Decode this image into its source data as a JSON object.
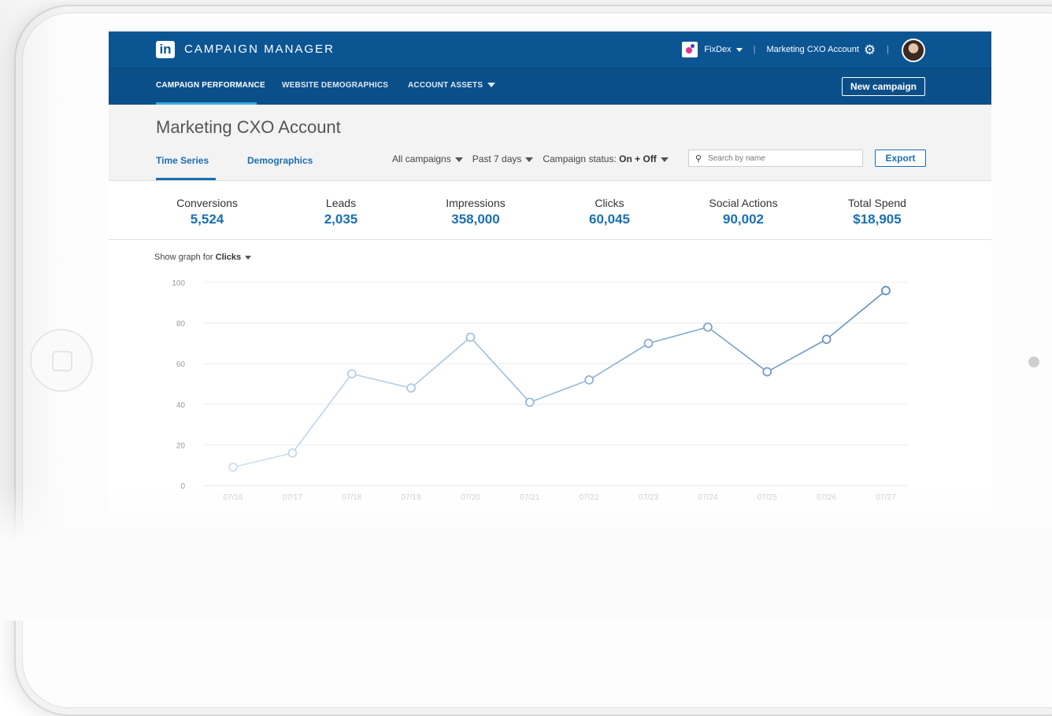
{
  "header": {
    "logo_text": "in",
    "app_title": "CAMPAIGN MANAGER",
    "org_name": "FixDex",
    "account_name": "Marketing CXO Account"
  },
  "nav": {
    "items": [
      {
        "label": "CAMPAIGN PERFORMANCE",
        "active": true
      },
      {
        "label": "WEBSITE DEMOGRAPHICS",
        "active": false
      },
      {
        "label": "ACCOUNT ASSETS",
        "active": false
      }
    ],
    "new_campaign_label": "New campaign"
  },
  "page": {
    "title": "Marketing CXO Account",
    "tabs": [
      {
        "label": "Time Series",
        "active": true
      },
      {
        "label": "Demographics",
        "active": false
      }
    ],
    "filters": {
      "campaigns": "All campaigns",
      "date_range": "Past 7 days",
      "status_label": "Campaign status:",
      "status_value": "On + Off"
    },
    "search_placeholder": "Search by name",
    "export_label": "Export"
  },
  "metrics": [
    {
      "label": "Conversions",
      "value": "5,524"
    },
    {
      "label": "Leads",
      "value": "2,035"
    },
    {
      "label": "Impressions",
      "value": "358,000"
    },
    {
      "label": "Clicks",
      "value": "60,045"
    },
    {
      "label": "Social Actions",
      "value": "90,002"
    },
    {
      "label": "Total Spend",
      "value": "$18,905"
    }
  ],
  "graph": {
    "show_label": "Show graph for",
    "metric": "Clicks"
  },
  "colors": {
    "topbar": "#0c5593",
    "accent": "#1a6fb5",
    "line": "#7aa6cf"
  },
  "chart_data": {
    "type": "line",
    "x": [
      "07/16",
      "07/17",
      "07/18",
      "07/19",
      "07/20",
      "07/21",
      "07/22",
      "07/23",
      "07/24",
      "07/25",
      "07/26",
      "07/27"
    ],
    "series": [
      {
        "values": [
          9,
          16,
          55,
          48,
          73,
          41,
          52,
          70,
          78,
          56,
          72,
          96
        ]
      }
    ],
    "ylim": [
      0,
      100
    ],
    "yticks": [
      0,
      20,
      40,
      60,
      80,
      100
    ],
    "grid": true
  }
}
